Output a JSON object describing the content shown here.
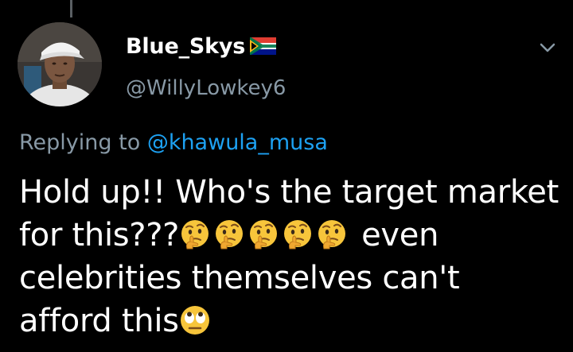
{
  "tweet": {
    "display_name": "Blue_Skys",
    "flag_icon": "south-africa-flag-icon",
    "handle": "@WillyLowkey6",
    "reply_prefix": "Replying to",
    "reply_mention": "@khawula_musa",
    "line1": "Hold up!! Who's the target market",
    "line2_start": "for this???",
    "line2_end": "even",
    "line3": "celebrities themselves can't",
    "line4": "afford this",
    "thinking_emoji_count": 5,
    "emoji_thinking": "thinking-face-icon",
    "emoji_eyeroll": "face-with-rolling-eyes-icon"
  },
  "colors": {
    "background": "#000000",
    "text": "#ffffff",
    "secondary_text": "#8899a6",
    "link": "#1da1f2",
    "thread_line": "#5a5f63"
  }
}
